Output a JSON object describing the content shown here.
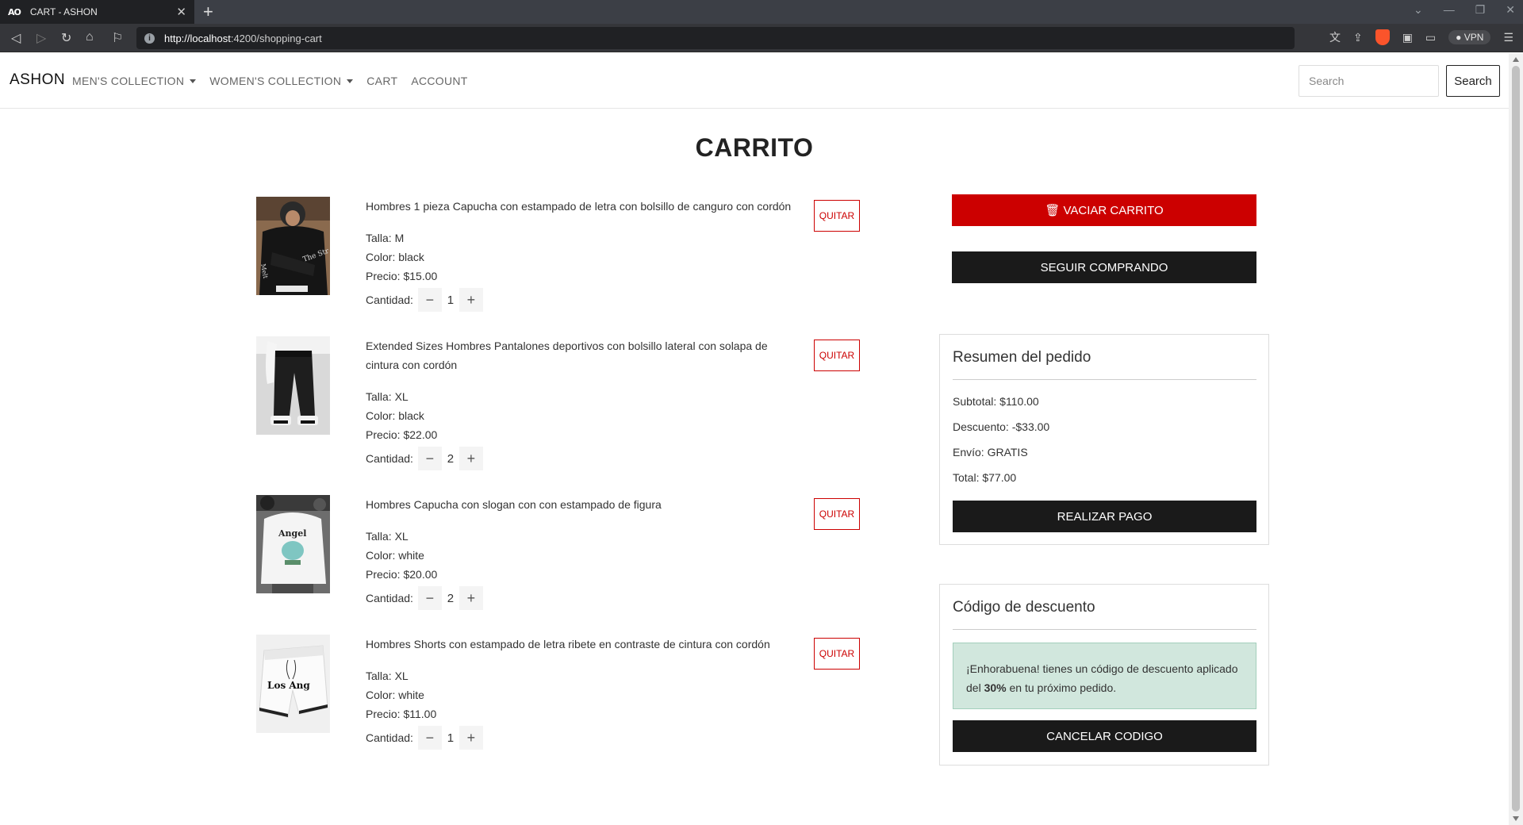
{
  "browser": {
    "tab_logo": "AO",
    "tab_title": "CART - ASHON",
    "url_host": "http://localhost",
    "url_path": ":4200/shopping-cart",
    "vpn_label": "VPN"
  },
  "nav": {
    "brand": "ASHON",
    "links": [
      "MEN'S COLLECTION",
      "WOMEN'S COLLECTION",
      "CART",
      "ACCOUNT"
    ],
    "search_placeholder": "Search",
    "search_button": "Search"
  },
  "page": {
    "title": "CARRITO"
  },
  "labels": {
    "size": "Talla: ",
    "color": "Color: ",
    "price": "Precio: ",
    "quantity": "Cantidad:",
    "remove": "QUITAR"
  },
  "items": [
    {
      "name": "Hombres 1 pieza Capucha con estampado de letra con bolsillo de canguro con cordón",
      "size": "M",
      "color": "black",
      "price": "$15.00",
      "quantity": "1"
    },
    {
      "name": "Extended Sizes Hombres Pantalones deportivos con bolsillo lateral con solapa de cintura con cordón",
      "size": "XL",
      "color": "black",
      "price": "$22.00",
      "quantity": "2"
    },
    {
      "name": "Hombres Capucha con slogan con con estampado de figura",
      "size": "XL",
      "color": "white",
      "price": "$20.00",
      "quantity": "2"
    },
    {
      "name": "Hombres Shorts con estampado de letra ribete en contraste de cintura con cordón",
      "size": "XL",
      "color": "white",
      "price": "$11.00",
      "quantity": "1"
    }
  ],
  "actions": {
    "empty_cart": "VACIAR CARRITO",
    "continue_shopping": "SEGUIR COMPRANDO"
  },
  "summary": {
    "title": "Resumen del pedido",
    "subtotal": "Subtotal: $110.00",
    "discount": "Descuento: -$33.00",
    "shipping": "Envío: GRATIS",
    "total": "Total: $77.00",
    "checkout": "REALIZAR PAGO"
  },
  "discount_code": {
    "title": "Código de descuento",
    "message_before": "¡Enhorabuena! tienes un código de descuento aplicado del ",
    "percent": "30%",
    "message_after": " en tu próximo pedido.",
    "cancel": "CANCELAR CODIGO"
  },
  "colors": {
    "danger": "#cc0000",
    "dark": "#1a1a1a",
    "success_bg": "#d1e7dd"
  },
  "icons": [
    "trash-icon",
    "minus-icon",
    "plus-icon"
  ]
}
